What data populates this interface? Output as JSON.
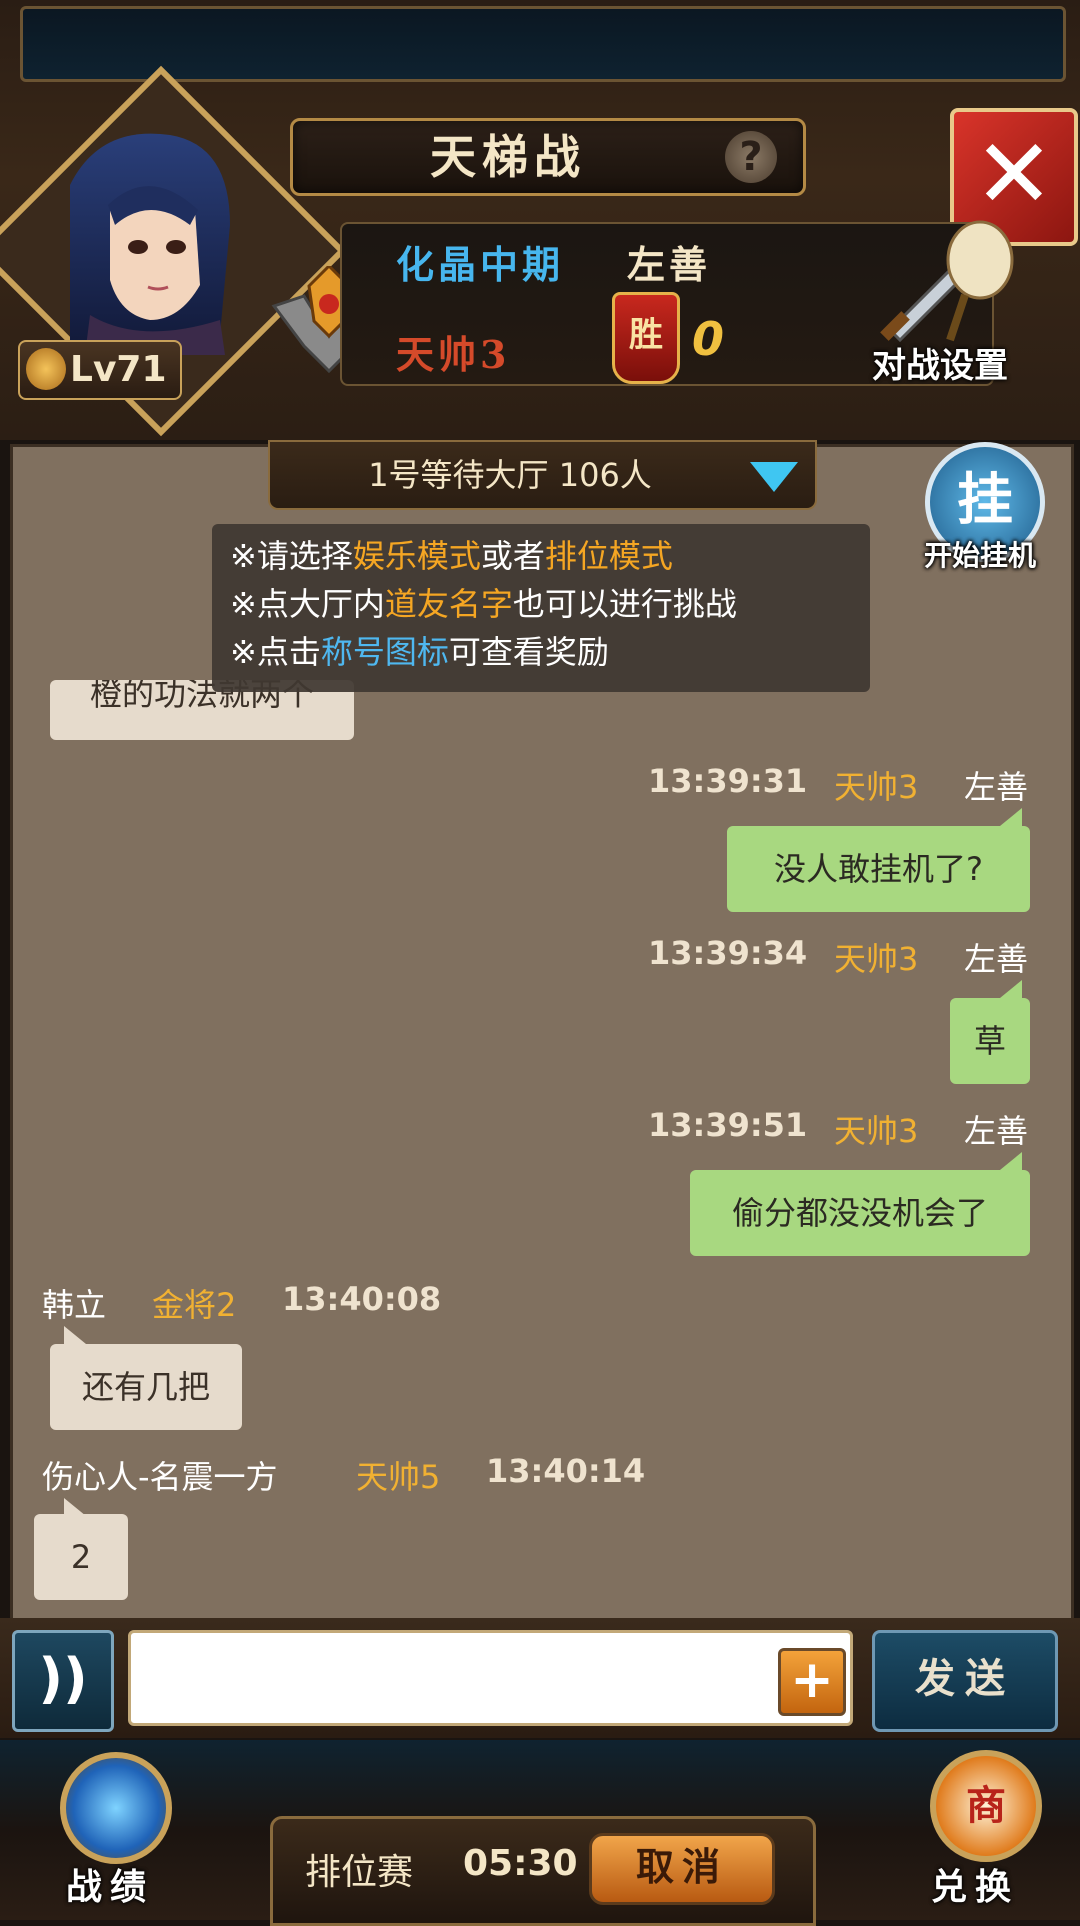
{
  "header": {
    "title": "天梯战",
    "help_label": "?",
    "close_label": "✕"
  },
  "player": {
    "level": "Lv71",
    "realm": "化晶中期",
    "name": "左善",
    "rank_title": "天帅3",
    "win_label": "胜",
    "win_count": "0"
  },
  "battle_settings": {
    "label": "对战设置"
  },
  "lobby": {
    "label": "1号等待大厅   106人"
  },
  "afk": {
    "icon_label": "挂",
    "label": "开始挂机"
  },
  "tips": {
    "line1_prefix": "※请选择",
    "line1_hl1": "娱乐模式",
    "line1_mid": "或者",
    "line1_hl2": "排位模式",
    "line2_prefix": "※点大厅内",
    "line2_hl": "道友名字",
    "line2_suffix": "也可以进行挑战",
    "line3_prefix": "※点击",
    "line3_hl": "称号图标",
    "line3_suffix": "可查看奖励"
  },
  "messages": {
    "partial": "橙的功法就两个",
    "m1": {
      "time": "13:39:31",
      "rank": "天帅3",
      "name": "左善",
      "text": "没人敢挂机了?"
    },
    "m2": {
      "time": "13:39:34",
      "rank": "天帅3",
      "name": "左善",
      "text": "草"
    },
    "m3": {
      "time": "13:39:51",
      "rank": "天帅3",
      "name": "左善",
      "text": "偷分都没没机会了"
    },
    "m4": {
      "name": "韩立",
      "rank": "金将2",
      "time": "13:40:08",
      "text": "还有几把"
    },
    "m5": {
      "name": "伤心人-名震一方",
      "rank": "天帅5",
      "time": "13:40:14",
      "text": "2"
    }
  },
  "input": {
    "voice_label": "))",
    "value": "",
    "plus_label": "+",
    "send_label": "发送"
  },
  "bottom": {
    "record_label": "战绩",
    "ranked_label": "排位赛",
    "ranked_timer": "05:30",
    "cancel_label": "取消",
    "exchange_icon": "商",
    "exchange_label": "兑换"
  },
  "colors": {
    "chat_bg": "#80705f",
    "own_bubble": "#a8d880",
    "other_bubble": "#e6dbcc",
    "rank_gold": "#f1b132",
    "realm_blue": "#47b6ee",
    "highlight_orange": "#f5a623",
    "highlight_blue": "#4fb8f0"
  },
  "icons": [
    "help-icon",
    "close-icon",
    "level-flame-icon",
    "rank-emblem-icon",
    "win-badge-icon",
    "crossed-swords-icon",
    "dropdown-arrow-icon",
    "afk-icon",
    "voice-icon",
    "plus-icon",
    "record-orb-icon",
    "exchange-icon"
  ]
}
